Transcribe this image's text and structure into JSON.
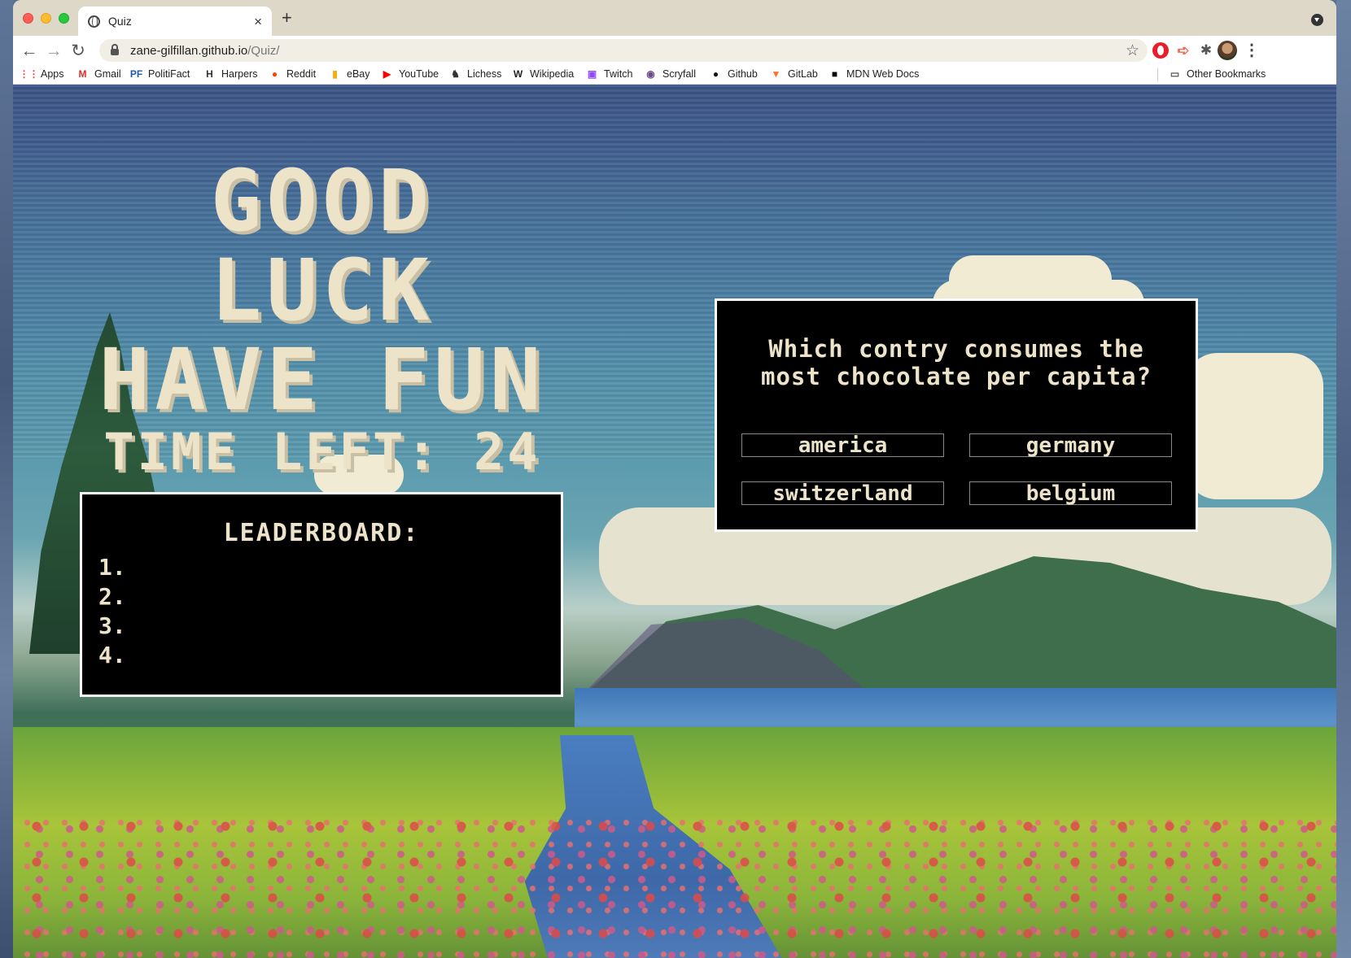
{
  "browser": {
    "tab_title": "Quiz",
    "tab_close": "×",
    "new_tab": "+",
    "url_host": "zane-gilfillan.github.io",
    "url_path": "/Quiz/",
    "back": "←",
    "forward": "→",
    "reload": "↻",
    "star": "☆",
    "kebab": "⋮"
  },
  "bookmarks": [
    {
      "label": "Apps",
      "icon": "apps-grid-icon",
      "glyph": "⋮⋮",
      "color": "#e8453c"
    },
    {
      "label": "Gmail",
      "icon": "gmail-icon",
      "glyph": "M",
      "color": "#d93025"
    },
    {
      "label": "PolitiFact",
      "icon": "politifact-icon",
      "glyph": "PF",
      "color": "#1e5aa8"
    },
    {
      "label": "Harpers",
      "icon": "harpers-icon",
      "glyph": "H",
      "color": "#333333"
    },
    {
      "label": "Reddit",
      "icon": "reddit-icon",
      "glyph": "●",
      "color": "#ff4500"
    },
    {
      "label": "eBay",
      "icon": "ebay-icon",
      "glyph": "▮",
      "color": "#f5af02"
    },
    {
      "label": "YouTube",
      "icon": "youtube-icon",
      "glyph": "▶",
      "color": "#ff0000"
    },
    {
      "label": "Lichess",
      "icon": "lichess-icon",
      "glyph": "♞",
      "color": "#333333"
    },
    {
      "label": "Wikipedia",
      "icon": "wikipedia-icon",
      "glyph": "W",
      "color": "#222222"
    },
    {
      "label": "Twitch",
      "icon": "twitch-icon",
      "glyph": "▣",
      "color": "#9146ff"
    },
    {
      "label": "Scryfall",
      "icon": "scryfall-icon",
      "glyph": "◉",
      "color": "#6b4a8a"
    },
    {
      "label": "Github",
      "icon": "github-icon",
      "glyph": "●",
      "color": "#111111"
    },
    {
      "label": "GitLab",
      "icon": "gitlab-icon",
      "glyph": "▼",
      "color": "#fc6d26"
    },
    {
      "label": "MDN Web Docs",
      "icon": "mdn-icon",
      "glyph": "■",
      "color": "#000000"
    },
    {
      "label": "Other Bookmarks",
      "icon": "folder-icon",
      "glyph": "▭",
      "color": "#555555"
    }
  ],
  "headline": {
    "line1": "GOOD",
    "line2": "LUCK",
    "line3": "HAVE FUN",
    "time_label": "TIME LEFT:",
    "time_value": "24"
  },
  "leaderboard": {
    "title": "LEADERBOARD:",
    "entries": [
      "1.",
      "2.",
      "3.",
      "4."
    ]
  },
  "question": {
    "text": "Which contry consumes the most chocolate per capita?",
    "answers": [
      "america",
      "germany",
      "switzerland",
      "belgium"
    ]
  }
}
